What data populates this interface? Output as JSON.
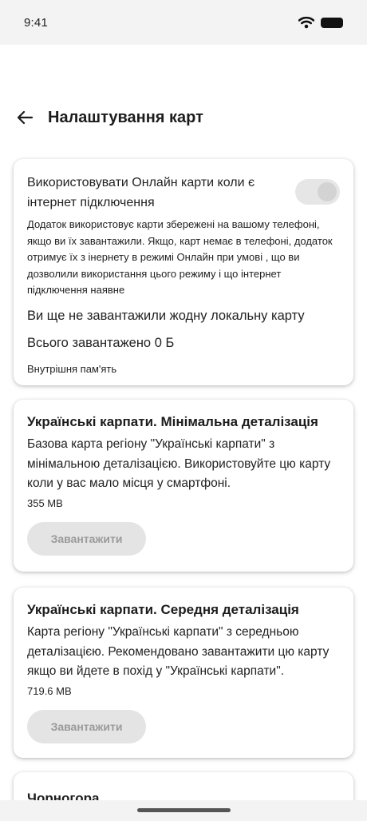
{
  "status_bar": {
    "time": "9:41"
  },
  "header": {
    "title": "Налаштування карт"
  },
  "settings_card": {
    "online_toggle_label": "Використовувати Онлайн карти коли є інтернет підключення",
    "online_toggle_state": "on (disabled)",
    "online_description": "Додаток використовує карти збережені на вашому телефоні, якщо ви їх завантажили. Якщо, карт немає в телефоні, додаток отримує їх з інернету в режимі Онлайн при умові , що ви дозволили використання цього режиму і що інтернет підключення наявне",
    "no_local_maps": "Ви ще не завантажили жодну локальну карту",
    "total_downloaded": "Всього завантажено 0 Б",
    "storage_label": "Внутрішня пам'ять"
  },
  "maps": [
    {
      "title": "Українські карпати. Мінімальна деталізація",
      "description": "Базова карта регіону \"Українські карпати\" з мінімальною деталізацією. Використовуйте цю карту коли у вас мало місця у смартфоні.",
      "size": "355 MB",
      "button_label": "Завантажити"
    },
    {
      "title": "Українські карпати. Середня деталізація",
      "description": "Карта регіону \"Українські карпати\" з середньою деталізацією. Рекомендовано завантажити цю карту якщо ви йдете в похід у \"Українські карпати\".",
      "size": "719.6 MB",
      "button_label": "Завантажити"
    },
    {
      "title": "Чорногора"
    }
  ]
}
